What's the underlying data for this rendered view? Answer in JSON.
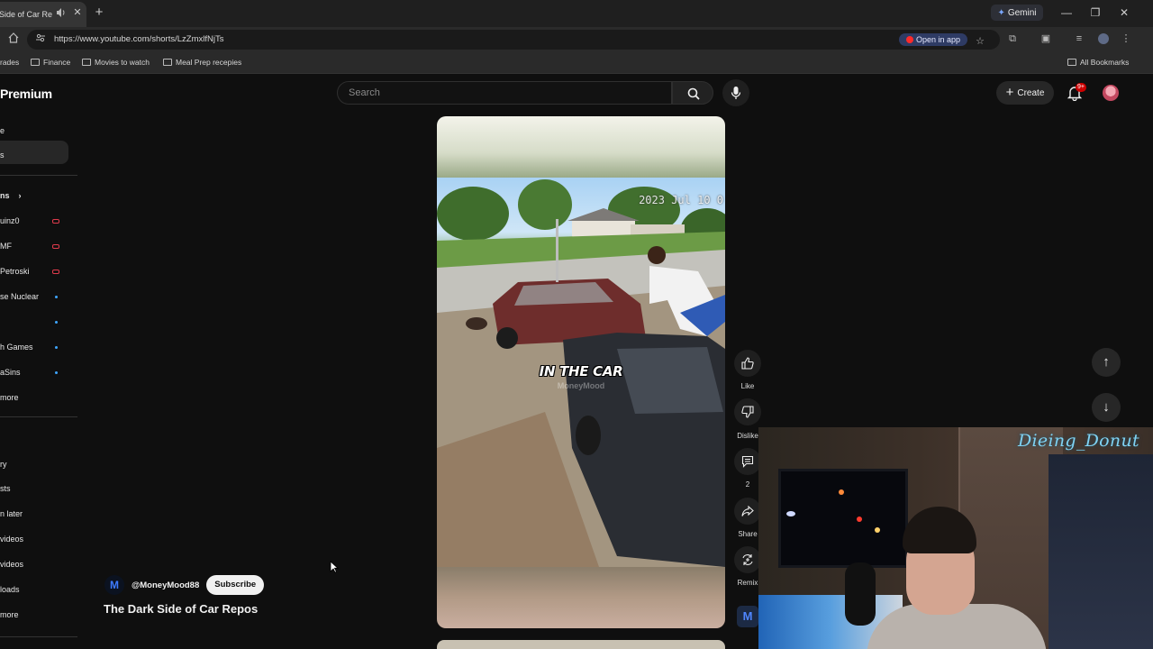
{
  "browser": {
    "tab_title": "k Side of Car Re",
    "new_tab_icon": "plus-icon",
    "gemini_label": "Gemini",
    "url": "https://www.youtube.com/shorts/LzZmxlfNjTs",
    "open_in_app": "Open in app",
    "bookmarks": [
      "rades",
      "Finance",
      "Movies to watch",
      "Meal Prep recepies"
    ],
    "all_bookmarks": "All Bookmarks"
  },
  "youtube": {
    "logo_text": "Premium",
    "search_placeholder": "Search",
    "create_label": "Create",
    "notification_count": "9+",
    "sidebar": {
      "top_items": [
        "e",
        "s"
      ],
      "subscriptions_header": "ns",
      "subscriptions": [
        {
          "label": "uinz0",
          "status": "live"
        },
        {
          "label": "MF",
          "status": "live"
        },
        {
          "label": "Petroski",
          "status": "live"
        },
        {
          "label": "se Nuclear",
          "status": "new"
        },
        {
          "label": "",
          "status": "new"
        },
        {
          "label": "h Games",
          "status": "new"
        },
        {
          "label": "aSins",
          "status": "new"
        },
        {
          "label": "more",
          "status": ""
        }
      ],
      "you_items": [
        "ry",
        "sts",
        "n later",
        "videos",
        "videos",
        "loads",
        "more"
      ]
    },
    "short": {
      "timestamp": "2023 Jul 10 0",
      "caption": "IN THE CAR",
      "watermark": "MoneyMood",
      "channel_handle": "@MoneyMood88",
      "subscribe_label": "Subscribe",
      "title": "The Dark Side of Car Repos",
      "actions": [
        {
          "icon": "like-icon",
          "label": "Like"
        },
        {
          "icon": "dislike-icon",
          "label": "Dislike"
        },
        {
          "icon": "comment-icon",
          "label": "2"
        },
        {
          "icon": "share-icon",
          "label": "Share"
        },
        {
          "icon": "remix-icon",
          "label": "Remix"
        }
      ]
    }
  },
  "webcam": {
    "streamer_name": "Dieing_Donut"
  },
  "colors": {
    "page_bg": "#0f0f0f",
    "live_red": "#e03b4c",
    "new_blue": "#3ea6ff",
    "name_cyan": "#7fd3f4"
  }
}
